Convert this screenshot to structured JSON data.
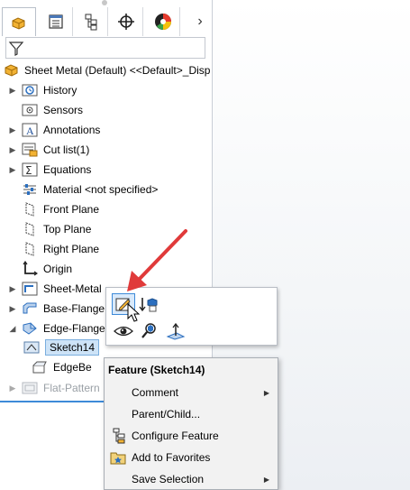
{
  "tabs": [
    {
      "name": "featuremanager-tab",
      "icon": "feature-tree-icon"
    },
    {
      "name": "propertymanager-tab",
      "icon": "property-list-icon"
    },
    {
      "name": "configurationmanager-tab",
      "icon": "configuration-icon"
    },
    {
      "name": "dimxpert-tab",
      "icon": "crosshair-icon"
    },
    {
      "name": "display-manager-tab",
      "icon": "appearance-pie-icon"
    }
  ],
  "tree": {
    "root_label": "Sheet Metal (Default) <<Default>_Disp",
    "items": [
      {
        "label": "History",
        "icon": "history-icon",
        "expandable": true
      },
      {
        "label": "Sensors",
        "icon": "sensor-icon",
        "expandable": false
      },
      {
        "label": "Annotations",
        "icon": "annotations-icon",
        "expandable": true
      },
      {
        "label": "Cut list(1)",
        "icon": "cut-list-icon",
        "expandable": true
      },
      {
        "label": "Equations",
        "icon": "equations-icon",
        "expandable": true
      },
      {
        "label": "Material <not specified>",
        "icon": "material-icon",
        "expandable": false
      },
      {
        "label": "Front Plane",
        "icon": "plane-icon",
        "expandable": false
      },
      {
        "label": "Top Plane",
        "icon": "plane-icon",
        "expandable": false
      },
      {
        "label": "Right Plane",
        "icon": "plane-icon",
        "expandable": false
      },
      {
        "label": "Origin",
        "icon": "origin-icon",
        "expandable": false
      },
      {
        "label": "Sheet-Metal",
        "icon": "sheet-metal-icon",
        "expandable": true
      },
      {
        "label": "Base-Flange",
        "icon": "base-flange-icon",
        "expandable": true
      },
      {
        "label": "Edge-Flange",
        "icon": "edge-flange-icon",
        "expandable": true,
        "expanded": true
      },
      {
        "label": "Sketch14",
        "icon": "sketch-icon",
        "expandable": false,
        "selected": true
      },
      {
        "label": "EdgeBe",
        "icon": "edge-bend-icon",
        "expandable": false
      },
      {
        "label": "Flat-Pattern",
        "icon": "flat-pattern-icon",
        "expandable": true,
        "dimmed": true
      }
    ]
  },
  "context_menu": {
    "title": "Feature (Sketch14)",
    "items": [
      {
        "label": "Comment",
        "icon": "",
        "submenu": true
      },
      {
        "label": "Parent/Child...",
        "icon": "",
        "submenu": false
      },
      {
        "label": "Configure Feature",
        "icon": "configure-feature-icon",
        "submenu": false
      },
      {
        "label": "Add to Favorites",
        "icon": "favorites-icon",
        "submenu": false
      },
      {
        "label": "Save Selection",
        "icon": "",
        "submenu": true
      }
    ]
  },
  "colors": {
    "accent": "#3d8ad8",
    "selection": "#cde3f7",
    "annotation_arrow": "#e03a3a"
  }
}
